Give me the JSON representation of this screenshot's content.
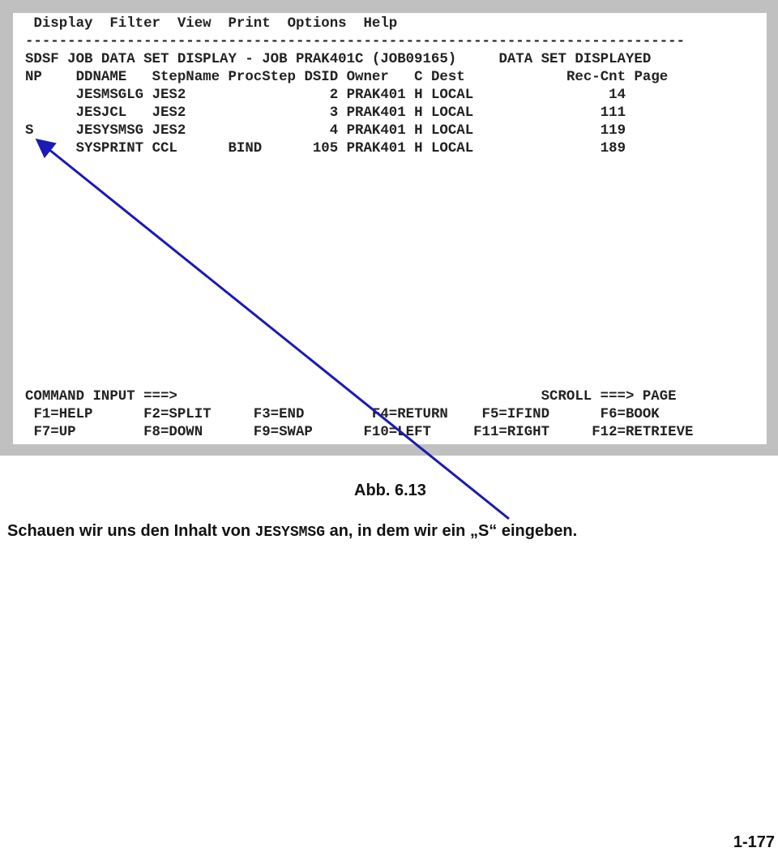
{
  "menu_bar": [
    "Display",
    "Filter",
    "View",
    "Print",
    "Options",
    "Help"
  ],
  "separator": "------------------------------------------------------------------------------",
  "title_line": {
    "left": "SDSF JOB DATA SET DISPLAY - JOB PRAK401C (JOB09165)",
    "right": "DATA SET DISPLAYED"
  },
  "table": {
    "columns": [
      "NP",
      "DDNAME",
      "StepName",
      "ProcStep",
      "DSID",
      "Owner",
      "C",
      "Dest",
      "Rec-Cnt",
      "Page"
    ],
    "rows": [
      {
        "np": "",
        "ddname": "JESMSGLG",
        "stepname": "JES2",
        "procstep": "",
        "dsid": "2",
        "owner": "PRAK401",
        "c": "H",
        "dest": "LOCAL",
        "rec_cnt": "14",
        "page": ""
      },
      {
        "np": "",
        "ddname": "JESJCL",
        "stepname": "JES2",
        "procstep": "",
        "dsid": "3",
        "owner": "PRAK401",
        "c": "H",
        "dest": "LOCAL",
        "rec_cnt": "111",
        "page": ""
      },
      {
        "np": "S",
        "ddname": "JESYSMSG",
        "stepname": "JES2",
        "procstep": "",
        "dsid": "4",
        "owner": "PRAK401",
        "c": "H",
        "dest": "LOCAL",
        "rec_cnt": "119",
        "page": ""
      },
      {
        "np": "",
        "ddname": "SYSPRINT",
        "stepname": "CCL",
        "procstep": "BIND",
        "dsid": "105",
        "owner": "PRAK401",
        "c": "H",
        "dest": "LOCAL",
        "rec_cnt": "189",
        "page": ""
      }
    ]
  },
  "command": {
    "label": "COMMAND INPUT ===>",
    "value": "",
    "scroll_label": "SCROLL ===>",
    "scroll_value": "PAGE"
  },
  "function_keys": [
    [
      "F1=HELP",
      "F2=SPLIT",
      "F3=END",
      "F4=RETURN",
      "F5=IFIND",
      "F6=BOOK"
    ],
    [
      "F7=UP",
      "F8=DOWN",
      "F9=SWAP",
      "F10=LEFT",
      "F11=RIGHT",
      "F12=RETRIEVE"
    ]
  ],
  "figure_caption": "Abb. 6.13",
  "description": {
    "before": "Schauen wir uns den Inhalt von ",
    "code": "JESYSMSG",
    "after": " an, in dem wir ein „S“ eingeben."
  },
  "page_number": "1-177",
  "arrow_color": "#1a1ab4"
}
